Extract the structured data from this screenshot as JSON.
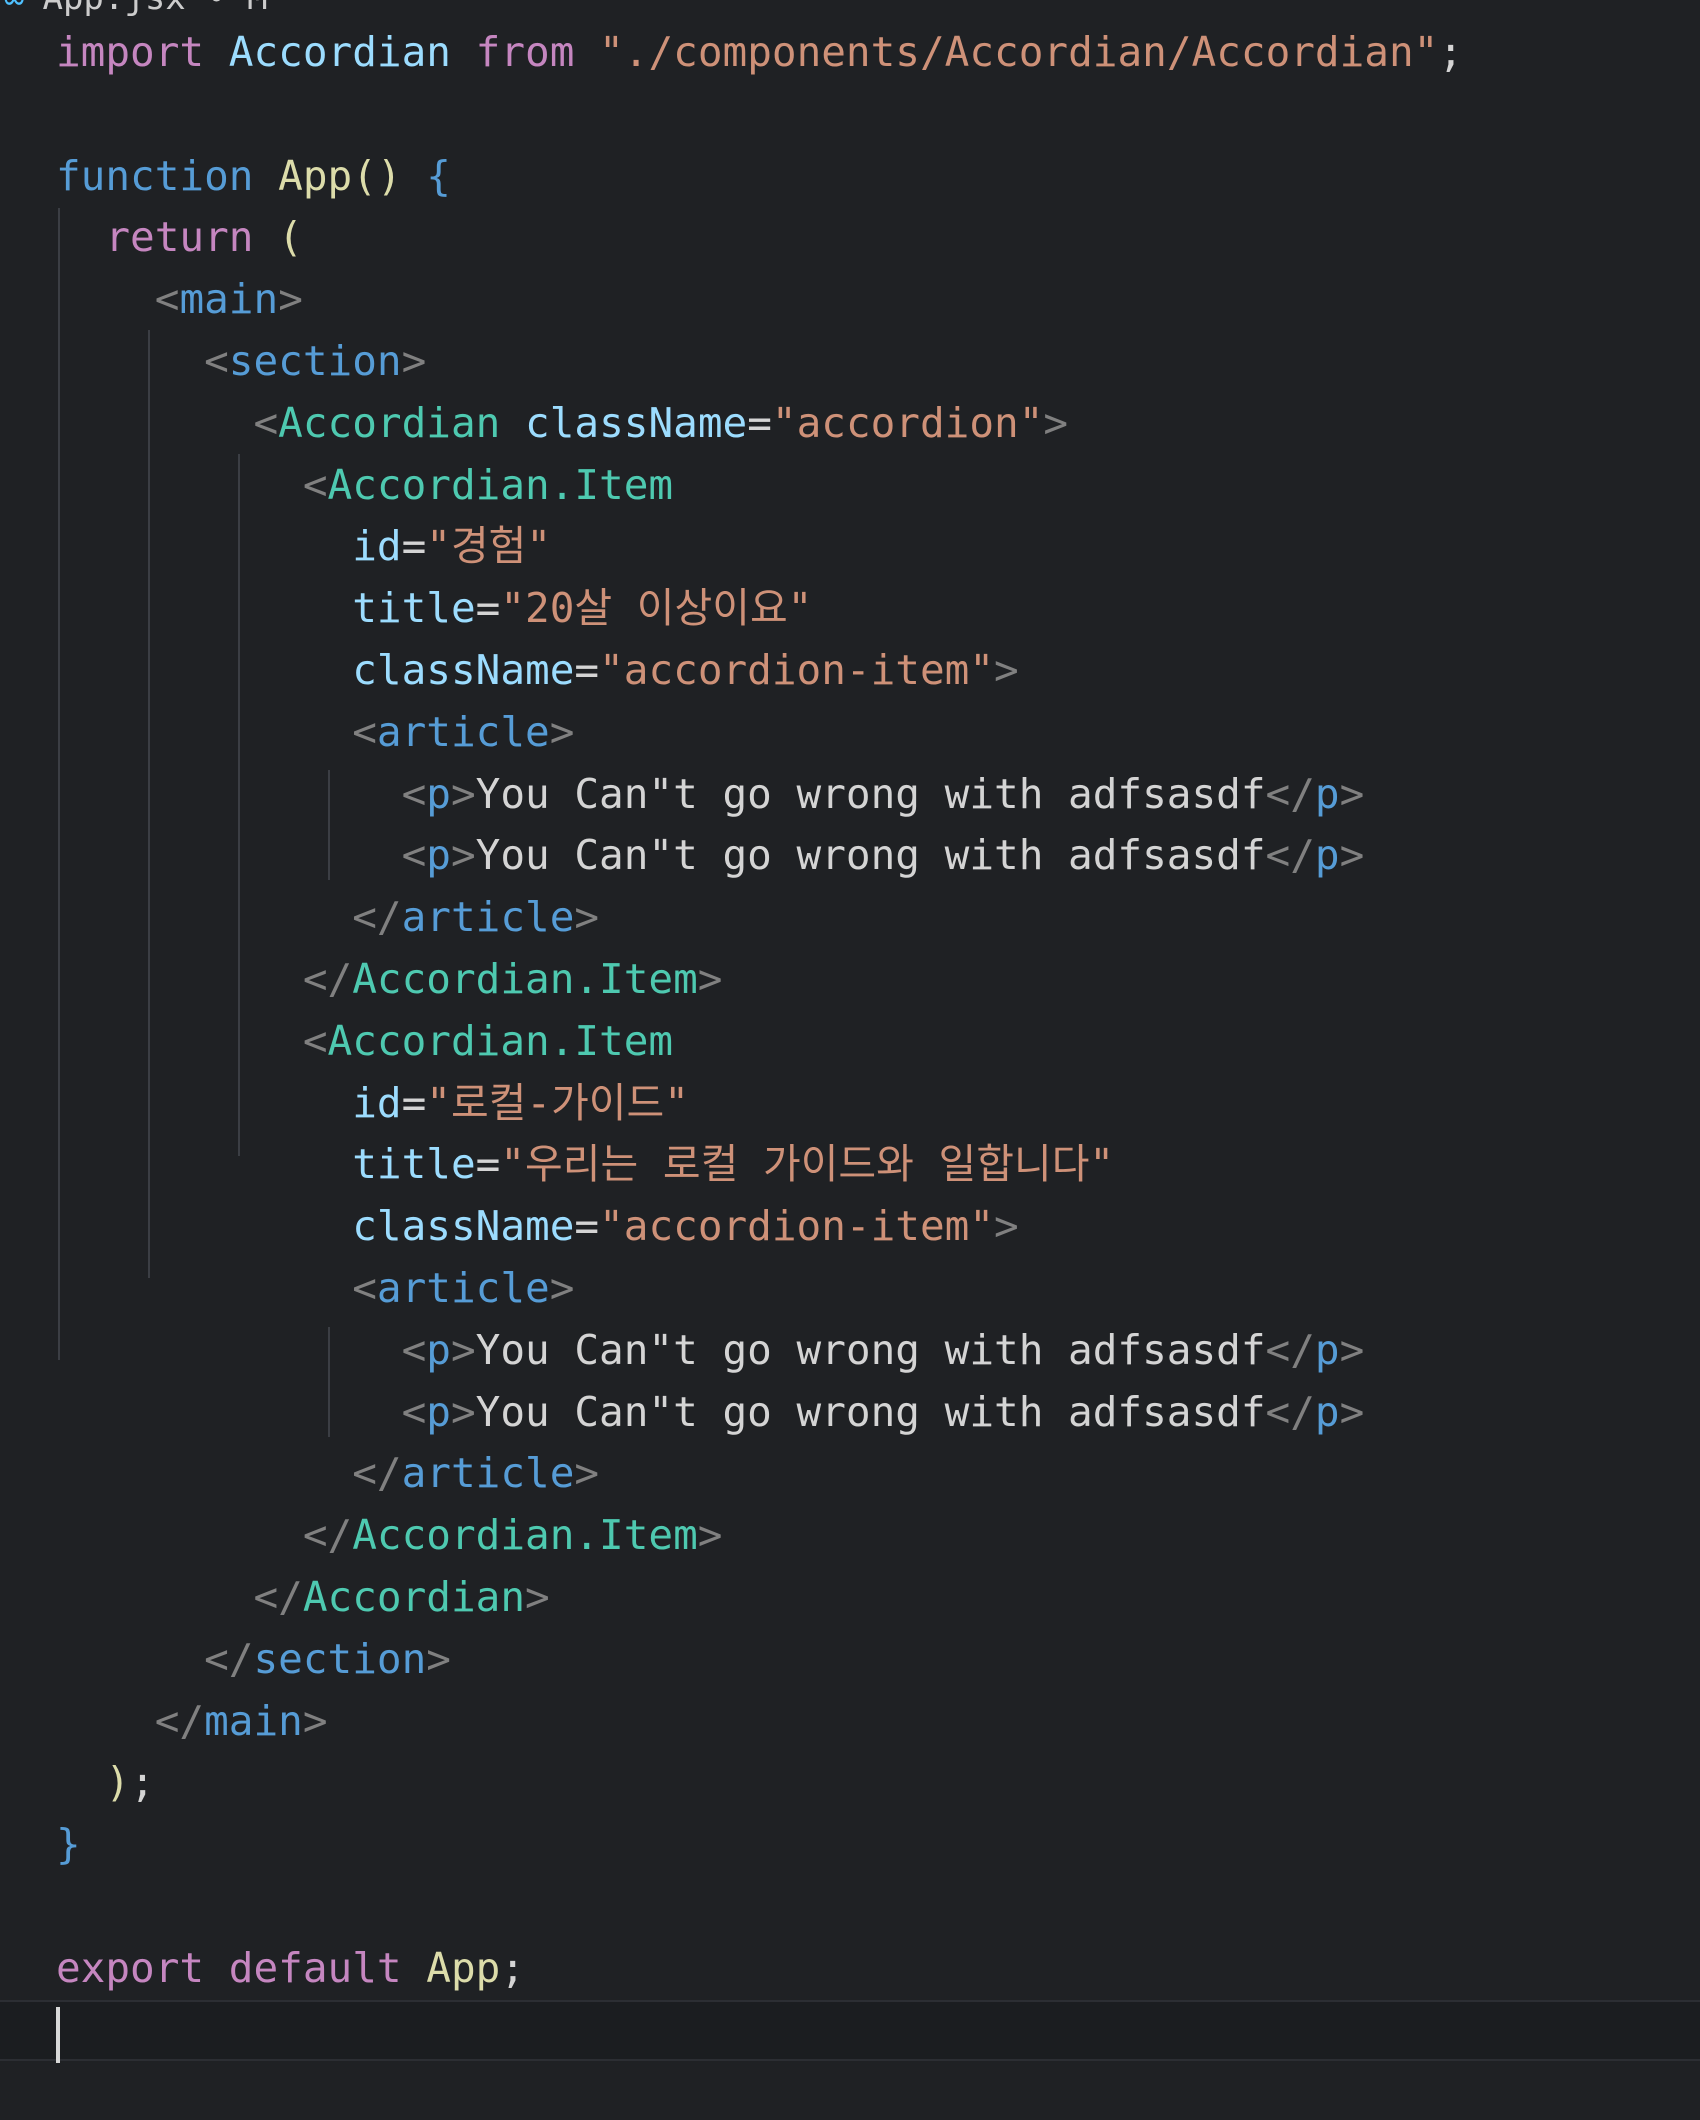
{
  "tab": {
    "label": "App.jsx • M"
  },
  "code": {
    "l1": {
      "kw": "import",
      "name": "Accordian",
      "from": "from",
      "path": "\"./components/Accordian/Accordian\"",
      "semi": ";"
    },
    "l3": {
      "kw": "function",
      "name": "App",
      "parens": "()",
      "brace": "{"
    },
    "l4": {
      "kw": "return",
      "paren": "("
    },
    "l5": {
      "open": "<",
      "tag": "main",
      "close": ">"
    },
    "l6": {
      "open": "<",
      "tag": "section",
      "close": ">"
    },
    "l7": {
      "open": "<",
      "tag": "Accordian",
      "attr": "className",
      "eq": "=",
      "val": "\"accordion\"",
      "close": ">"
    },
    "l8": {
      "open": "<",
      "tag": "Accordian.Item"
    },
    "l9": {
      "attr": "id",
      "eq": "=",
      "val": "\"경험\""
    },
    "l10": {
      "attr": "title",
      "eq": "=",
      "val": "\"20살 이상이요\""
    },
    "l11": {
      "attr": "className",
      "eq": "=",
      "val": "\"accordion-item\"",
      "close": ">"
    },
    "l12": {
      "open": "<",
      "tag": "article",
      "close": ">"
    },
    "l13": {
      "open": "<",
      "tag": "p",
      "close": ">",
      "text": "You Can\"t go wrong with adfsasdf",
      "end_open": "</",
      "end_tag": "p",
      "end_close": ">"
    },
    "l14": {
      "open": "<",
      "tag": "p",
      "close": ">",
      "text": "You Can\"t go wrong with adfsasdf",
      "end_open": "</",
      "end_tag": "p",
      "end_close": ">"
    },
    "l15": {
      "open": "</",
      "tag": "article",
      "close": ">"
    },
    "l16": {
      "open": "</",
      "tag": "Accordian.Item",
      "close": ">"
    },
    "l17": {
      "open": "<",
      "tag": "Accordian.Item"
    },
    "l18": {
      "attr": "id",
      "eq": "=",
      "val": "\"로컬-가이드\""
    },
    "l19": {
      "attr": "title",
      "eq": "=",
      "val": "\"우리는 로컬 가이드와 일합니다\""
    },
    "l20": {
      "attr": "className",
      "eq": "=",
      "val": "\"accordion-item\"",
      "close": ">"
    },
    "l21": {
      "open": "<",
      "tag": "article",
      "close": ">"
    },
    "l22": {
      "open": "<",
      "tag": "p",
      "close": ">",
      "text": "You Can\"t go wrong with adfsasdf",
      "end_open": "</",
      "end_tag": "p",
      "end_close": ">"
    },
    "l23": {
      "open": "<",
      "tag": "p",
      "close": ">",
      "text": "You Can\"t go wrong with adfsasdf",
      "end_open": "</",
      "end_tag": "p",
      "end_close": ">"
    },
    "l24": {
      "open": "</",
      "tag": "article",
      "close": ">"
    },
    "l25": {
      "open": "</",
      "tag": "Accordian.Item",
      "close": ">"
    },
    "l26": {
      "open": "</",
      "tag": "Accordian",
      "close": ">"
    },
    "l27": {
      "open": "</",
      "tag": "section",
      "close": ">"
    },
    "l28": {
      "open": "</",
      "tag": "main",
      "close": ">"
    },
    "l29": {
      "paren": ")",
      "semi": ";"
    },
    "l30": {
      "brace": "}"
    },
    "l32": {
      "kw1": "export",
      "kw2": "default",
      "name": "App",
      "semi": ";"
    }
  },
  "colors": {
    "background": "#1f2124",
    "keyword": "#c586c0",
    "function": "#dcdcaa",
    "variable": "#9cdcfe",
    "string": "#ce9178",
    "tag": "#569cd6",
    "component": "#4ec9b0"
  }
}
